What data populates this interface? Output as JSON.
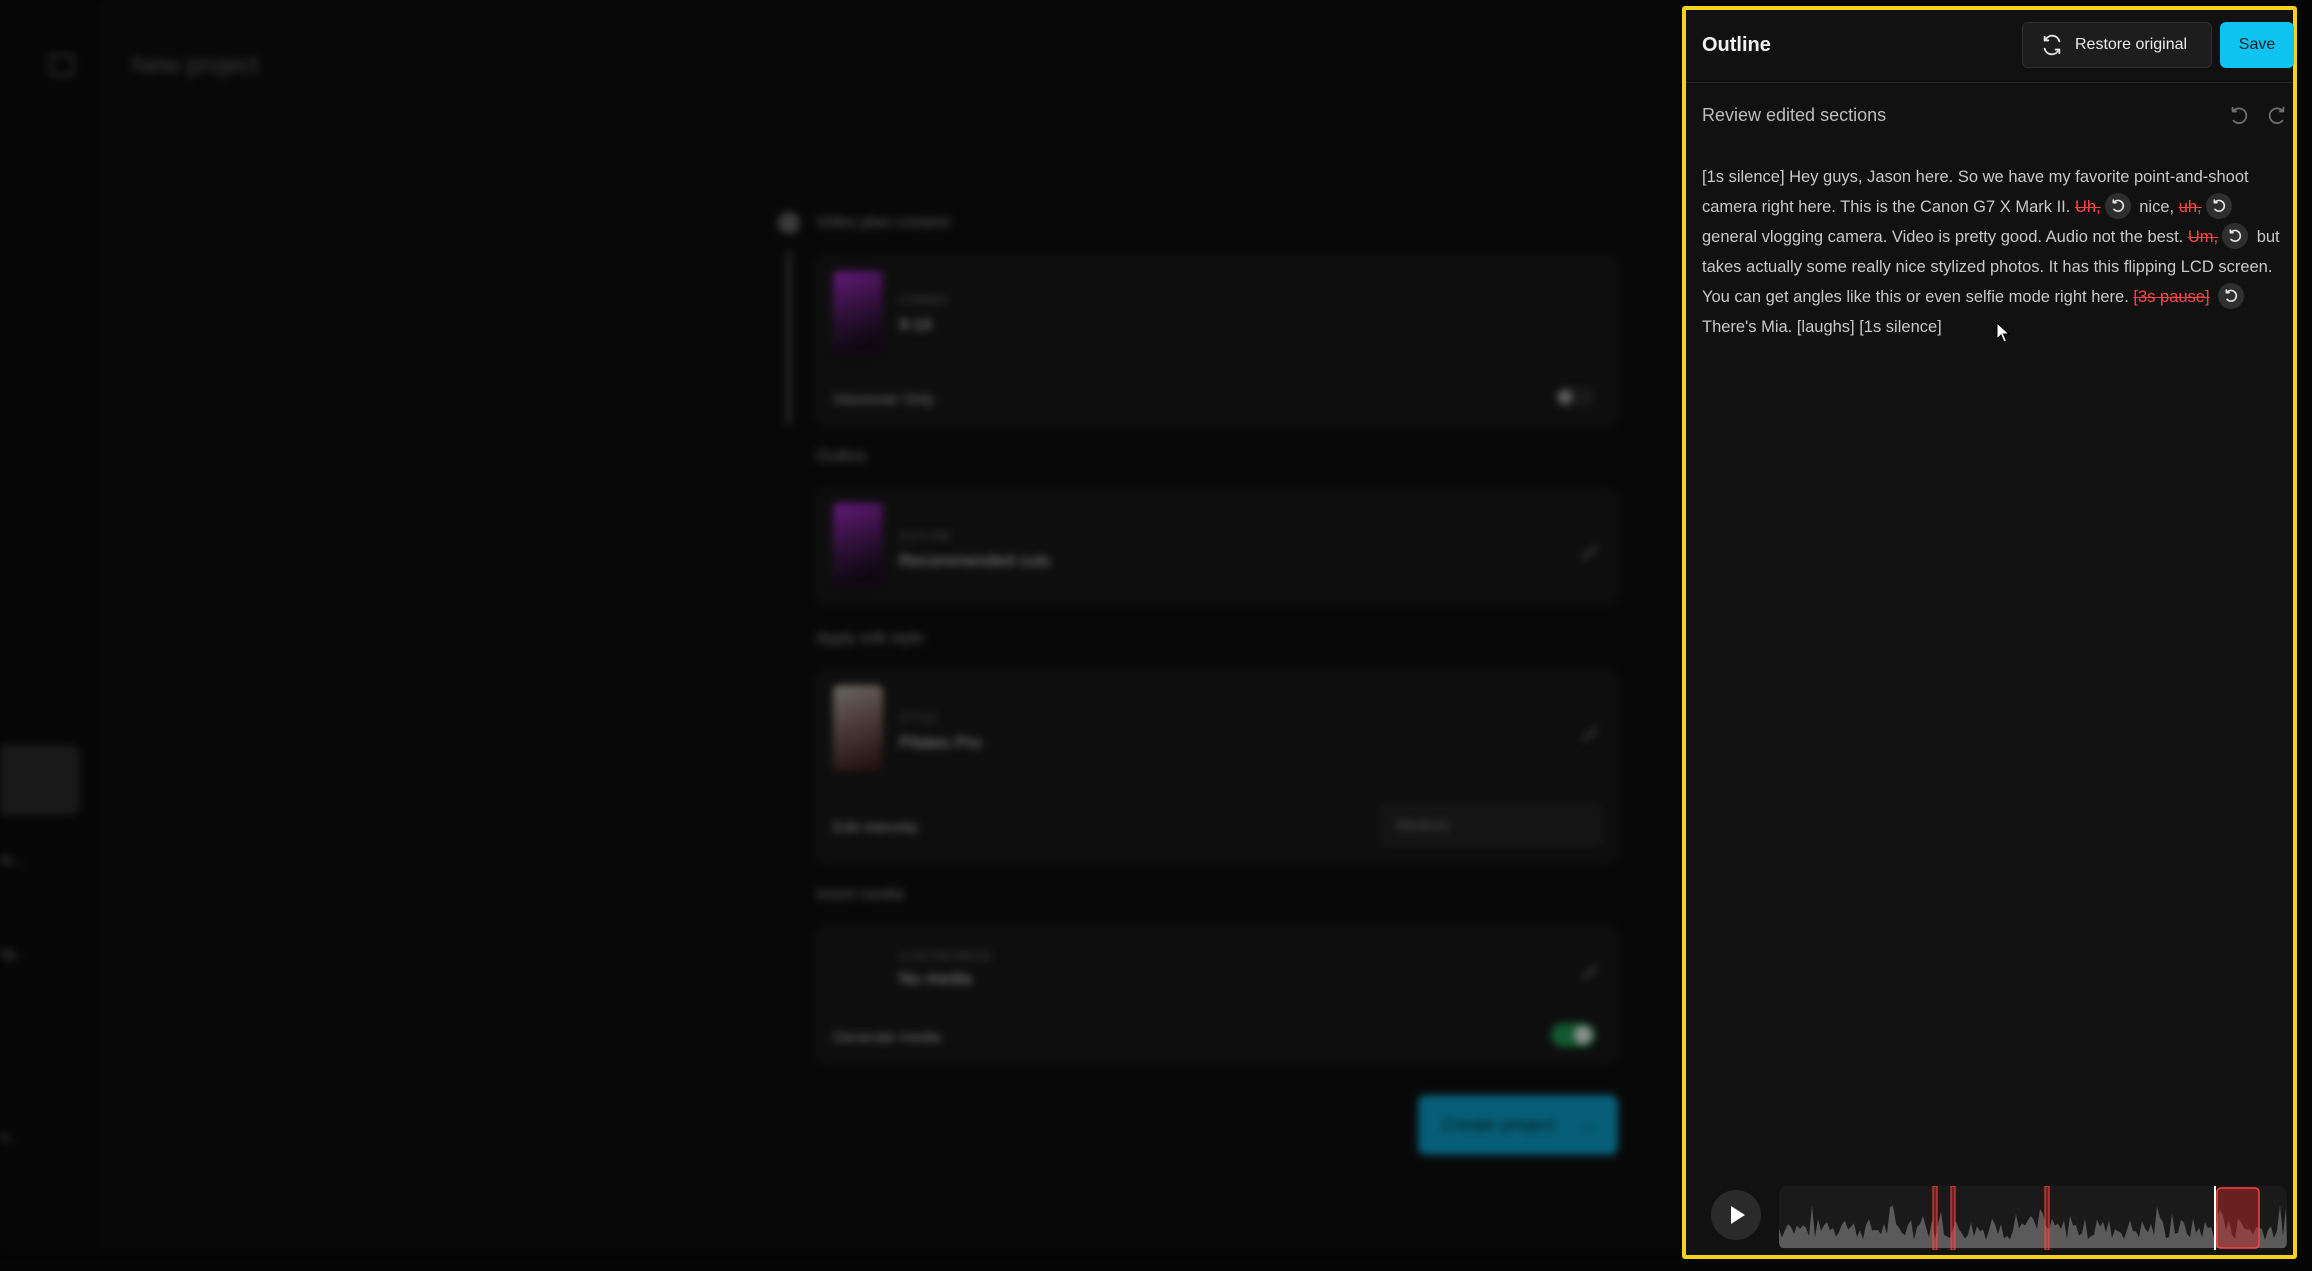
{
  "background": {
    "header_title": "New project",
    "sidebar_snippets": [
      "lo...",
      "rg...",
      "s..."
    ],
    "steps": [
      {
        "label": "Video plan created"
      },
      {
        "label": "Outline"
      },
      {
        "label": "Apply edit style"
      },
      {
        "label": "Insert media"
      }
    ],
    "card_format": {
      "key": "FORMAT",
      "value": "9:16",
      "row_label": "Voiceover Only"
    },
    "card_outline": {
      "key": "OUTLINE",
      "value": "Recommended cuts"
    },
    "card_style": {
      "key": "STYLE",
      "value": "Pilates Pro",
      "row_label": "Edit intensity",
      "select_value": "Medium"
    },
    "card_media": {
      "key": "CUSTOM MEDIA",
      "value": "No media",
      "row_label": "Generate media"
    },
    "create_button": "Create project",
    "create_arrow": "→"
  },
  "panel": {
    "title": "Outline",
    "restore_label": "Restore original",
    "save_label": "Save",
    "review_label": "Review edited sections",
    "transcript": {
      "t1": "[1s silence] Hey guys, Jason here. So we have my favorite point-and-shoot camera right here. This is the Canon G7 X Mark II.",
      "s1": "Uh,",
      "t2": "nice,",
      "s2": "uh,",
      "t3": "general vlogging camera. Video is pretty good. Audio not the best.",
      "s3": "Um,",
      "t4": "but takes actually some really nice stylized photos. It has this flipping LCD screen. You can get angles like this or even selfie mode right here.",
      "s4": "[3s pause]",
      "t5": "There's Mia. [laughs] [1s silence]"
    }
  },
  "colors": {
    "accent": "#0ec3ef",
    "highlight_border": "#f2d31a",
    "removed_text": "#ff4545",
    "panel_bg": "#111111"
  }
}
